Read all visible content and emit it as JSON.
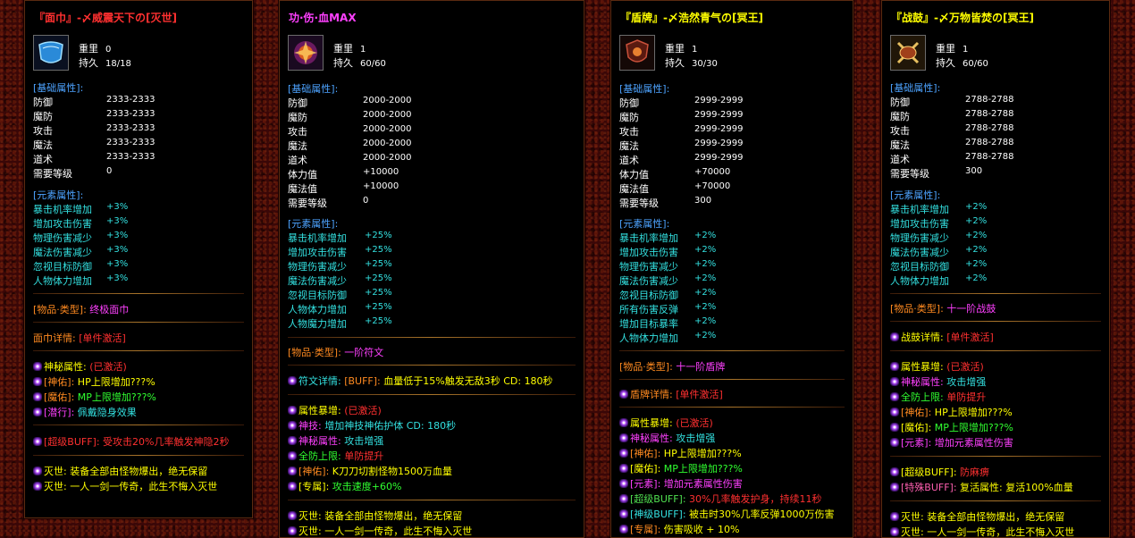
{
  "panels": [
    {
      "title": "『面巾』-〆威震天下の[灭世]",
      "icon": "blue-cloth-icon",
      "weight_label": "重里",
      "weight": "0",
      "durability_label": "持久",
      "durability": "18/18",
      "base_header": "[基础属性]:",
      "base": [
        {
          "k": "防御",
          "v": "2333-2333"
        },
        {
          "k": "魔防",
          "v": "2333-2333"
        },
        {
          "k": "攻击",
          "v": "2333-2333"
        },
        {
          "k": "魔法",
          "v": "2333-2333"
        },
        {
          "k": "道术",
          "v": "2333-2333"
        },
        {
          "k": "需要等级",
          "v": "0"
        }
      ],
      "elem_header": "[元素属性]:",
      "elem": [
        {
          "k": "暴击机率增加",
          "v": "+3%"
        },
        {
          "k": "增加攻击伤害",
          "v": "+3%"
        },
        {
          "k": "物理伤害减少",
          "v": "+3%"
        },
        {
          "k": "魔法伤害减少",
          "v": "+3%"
        },
        {
          "k": "忽视目标防御",
          "v": "+3%"
        },
        {
          "k": "人物体力增加",
          "v": "+3%"
        }
      ],
      "type_label": "[物品·类型]:",
      "type_value": "终极面巾",
      "detail_label": "面巾详情:",
      "detail_value": "[单件激活]",
      "mystic_label": "神秘属性:",
      "mystic_value": "(已激活)",
      "effects": [
        {
          "a": "[神佑]:",
          "b": "HP上限增加???%"
        },
        {
          "a": "[魔佑]:",
          "b": "MP上限增加???%"
        },
        {
          "a": "[潜行]:",
          "b": "佩戴隐身效果"
        }
      ],
      "super": "[超级BUFF]: 受攻击20%几率触发神隐2秒",
      "mie1": "灭世: 装备全部由怪物爆出，绝无保留",
      "mie2": "灭世: 一人一剑一传奇，此生不悔入灭世"
    },
    {
      "title": "功·伤·血MAX",
      "icon": "fire-rune-icon",
      "weight_label": "重里",
      "weight": "1",
      "durability_label": "持久",
      "durability": "60/60",
      "base_header": "[基础属性]:",
      "base": [
        {
          "k": "防御",
          "v": "2000-2000"
        },
        {
          "k": "魔防",
          "v": "2000-2000"
        },
        {
          "k": "攻击",
          "v": "2000-2000"
        },
        {
          "k": "魔法",
          "v": "2000-2000"
        },
        {
          "k": "道术",
          "v": "2000-2000"
        },
        {
          "k": "体力值",
          "v": "+10000"
        },
        {
          "k": "魔法值",
          "v": "+10000"
        },
        {
          "k": "需要等级",
          "v": "0"
        }
      ],
      "elem_header": "[元素属性]:",
      "elem": [
        {
          "k": "暴击机率增加",
          "v": "+25%"
        },
        {
          "k": "增加攻击伤害",
          "v": "+25%"
        },
        {
          "k": "物理伤害减少",
          "v": "+25%"
        },
        {
          "k": "魔法伤害减少",
          "v": "+25%"
        },
        {
          "k": "忽视目标防御",
          "v": "+25%"
        },
        {
          "k": "人物体力增加",
          "v": "+25%"
        },
        {
          "k": "人物魔力增加",
          "v": "+25%"
        }
      ],
      "type_label": "[物品·类型]:",
      "type_value": "一阶符文",
      "rune_label": "符文详情:",
      "rune_buff": "[BUFF]:",
      "rune_value": "血量低于15%触发无敌3秒 CD: 180秒",
      "burst_label": "属性暴增:",
      "burst_value": "(已激活)",
      "effects": [
        {
          "a": "神技:",
          "b": "增加神技神佑护体 CD: 180秒"
        },
        {
          "a": "神秘属性:",
          "b": "攻击增强"
        },
        {
          "a": "全防上限:",
          "b": "单防提升"
        },
        {
          "a": "[神佑]:",
          "b": "K刀刀切割怪物1500万血量"
        },
        {
          "a": "[专属]:",
          "b": "攻击速度+60%"
        }
      ],
      "mie1": "灭世: 装备全部由怪物爆出，绝无保留",
      "mie2": "灭世: 一人一剑一传奇，此生不悔入灭世"
    },
    {
      "title": "『盾牌』-〆浩然青气の[冥王]",
      "icon": "dark-shield-icon",
      "weight_label": "重里",
      "weight": "1",
      "durability_label": "持久",
      "durability": "30/30",
      "base_header": "[基础属性]:",
      "base": [
        {
          "k": "防御",
          "v": "2999-2999"
        },
        {
          "k": "魔防",
          "v": "2999-2999"
        },
        {
          "k": "攻击",
          "v": "2999-2999"
        },
        {
          "k": "魔法",
          "v": "2999-2999"
        },
        {
          "k": "道术",
          "v": "2999-2999"
        },
        {
          "k": "体力值",
          "v": "+70000"
        },
        {
          "k": "魔法值",
          "v": "+70000"
        },
        {
          "k": "需要等级",
          "v": "300"
        }
      ],
      "elem_header": "[元素属性]:",
      "elem": [
        {
          "k": "暴击机率增加",
          "v": "+2%"
        },
        {
          "k": "增加攻击伤害",
          "v": "+2%"
        },
        {
          "k": "物理伤害减少",
          "v": "+2%"
        },
        {
          "k": "魔法伤害减少",
          "v": "+2%"
        },
        {
          "k": "忽视目标防御",
          "v": "+2%"
        },
        {
          "k": "所有伤害反弹",
          "v": "+2%"
        },
        {
          "k": "增加目标暴率",
          "v": "+2%"
        },
        {
          "k": "人物体力增加",
          "v": "+2%"
        }
      ],
      "type_label": "[物品·类型]:",
      "type_value": "十一阶盾牌",
      "detail_label": "盾牌详情:",
      "detail_value": "[单件激活]",
      "burst_label": "属性暴增:",
      "burst_value": "(已激活)",
      "effects": [
        {
          "a": "神秘属性:",
          "b": "攻击增强"
        },
        {
          "a": "[神佑]:",
          "b": "HP上限增加???%"
        },
        {
          "a": "[魔佑]:",
          "b": "MP上限增加???%"
        },
        {
          "a": "[元素]:",
          "b": "增加元素属性伤害"
        },
        {
          "a": "[超级BUFF]:",
          "b": "30%几率触发护身，持续11秒"
        },
        {
          "a": "[神级BUFF]:",
          "b": "被击时30%几率反弹1000万伤害"
        },
        {
          "a": "[专属]:",
          "b": "伤害吸收 + 10%"
        }
      ]
    },
    {
      "title": "『战鼓』-〆万物皆焚の[冥王]",
      "icon": "war-drum-icon",
      "weight_label": "重里",
      "weight": "1",
      "durability_label": "持久",
      "durability": "60/60",
      "base_header": "[基础属性]:",
      "base": [
        {
          "k": "防御",
          "v": "2788-2788"
        },
        {
          "k": "魔防",
          "v": "2788-2788"
        },
        {
          "k": "攻击",
          "v": "2788-2788"
        },
        {
          "k": "魔法",
          "v": "2788-2788"
        },
        {
          "k": "道术",
          "v": "2788-2788"
        },
        {
          "k": "需要等级",
          "v": "300"
        }
      ],
      "elem_header": "[元素属性]:",
      "elem": [
        {
          "k": "暴击机率增加",
          "v": "+2%"
        },
        {
          "k": "增加攻击伤害",
          "v": "+2%"
        },
        {
          "k": "物理伤害减少",
          "v": "+2%"
        },
        {
          "k": "魔法伤害减少",
          "v": "+2%"
        },
        {
          "k": "忽视目标防御",
          "v": "+2%"
        },
        {
          "k": "人物体力增加",
          "v": "+2%"
        }
      ],
      "type_label": "[物品·类型]:",
      "type_value": "十一阶战鼓",
      "detail_label": "战鼓详情:",
      "detail_value": "[单件激活]",
      "burst_label": "属性暴增:",
      "burst_value": "(已激活)",
      "effects": [
        {
          "a": "神秘属性:",
          "b": "攻击增强"
        },
        {
          "a": "全防上限:",
          "b": "单防提升"
        },
        {
          "a": "[神佑]:",
          "b": "HP上限增加???%"
        },
        {
          "a": "[魔佑]:",
          "b": "MP上限增加???%"
        },
        {
          "a": "[元素]:",
          "b": "增加元素属性伤害"
        }
      ],
      "buffs": [
        {
          "a": "[超级BUFF]:",
          "b": "防麻痹"
        },
        {
          "a": "[特殊BUFF]:",
          "b": "复活属性: 复活100%血量"
        }
      ],
      "mie1": "灭世: 装备全部由怪物爆出，绝无保留",
      "mie2": "灭世: 一人一剑一传奇，此生不悔入灭世"
    }
  ]
}
